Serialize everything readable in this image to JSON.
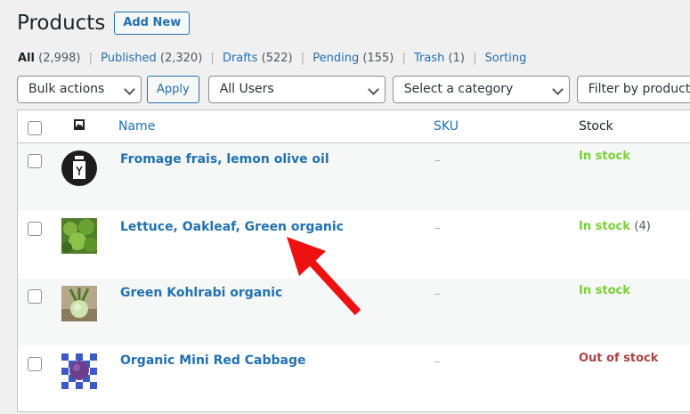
{
  "header": {
    "title": "Products",
    "add_new": "Add New"
  },
  "views": [
    {
      "label": "All",
      "count": "(2,998)"
    },
    {
      "label": "Published",
      "count": "(2,320)"
    },
    {
      "label": "Drafts",
      "count": "(522)"
    },
    {
      "label": "Pending",
      "count": "(155)"
    },
    {
      "label": "Trash",
      "count": "(1)"
    },
    {
      "label": "Sorting",
      "count": ""
    }
  ],
  "filters": {
    "bulk_actions": "Bulk actions",
    "apply": "Apply",
    "users": "All Users",
    "category": "Select a category",
    "product_type": "Filter by product type"
  },
  "columns": {
    "name": "Name",
    "sku": "SKU",
    "stock": "Stock"
  },
  "rows": [
    {
      "name": "Fromage frais, lemon olive oil",
      "sku": "–",
      "stock": "In stock",
      "qty": ""
    },
    {
      "name": "Lettuce, Oakleaf, Green organic",
      "sku": "–",
      "stock": "In stock",
      "qty": "(4)"
    },
    {
      "name": "Green Kohlrabi organic",
      "sku": "–",
      "stock": "In stock",
      "qty": ""
    },
    {
      "name": "Organic Mini Red Cabbage",
      "sku": "–",
      "stock": "Out of stock",
      "qty": ""
    }
  ],
  "colors": {
    "accent": "#2271b1",
    "in_stock": "#7ad03a",
    "out_of_stock": "#aa4444",
    "annotation_arrow": "#ee1111"
  }
}
